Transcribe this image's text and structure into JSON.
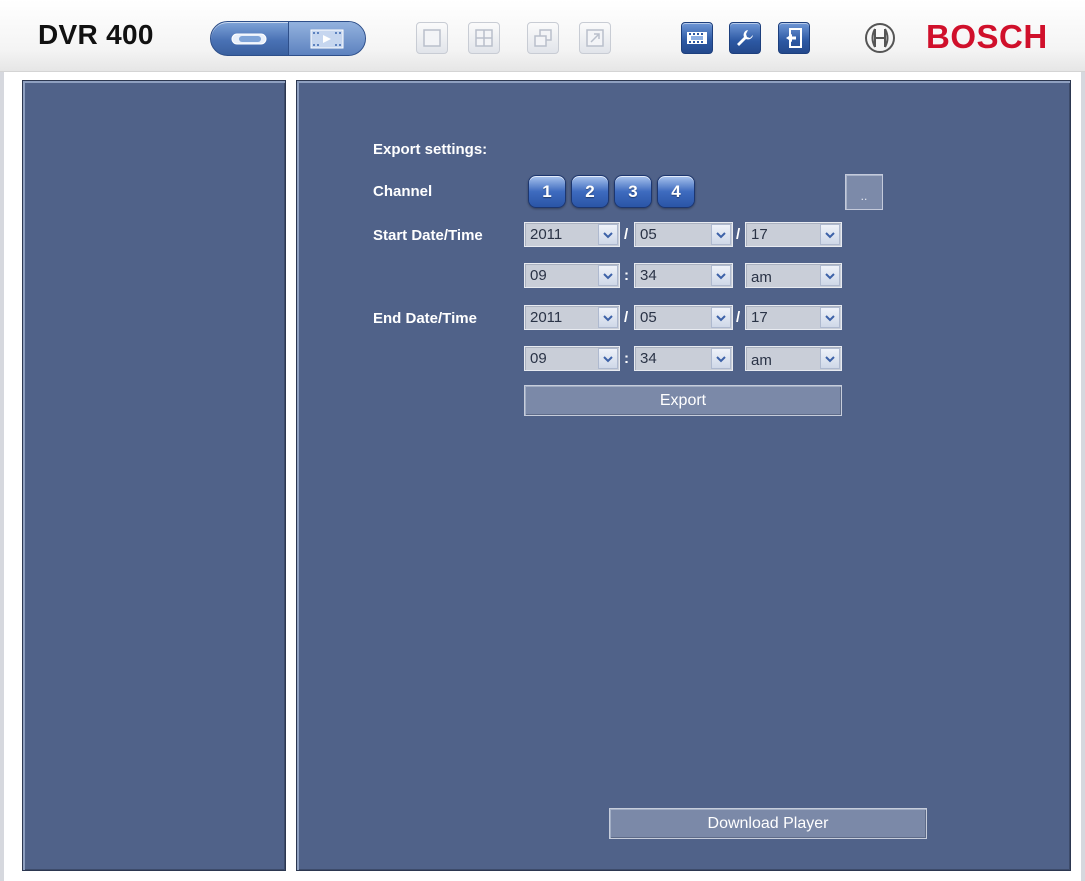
{
  "header": {
    "title": "DVR 400",
    "brand": "BOSCH",
    "icons": {
      "live": "live-view-icon",
      "playback": "playback-icon",
      "single_view": "single-view-icon",
      "quad_view": "quad-view-icon",
      "restore": "restore-window-icon",
      "fullscreen": "fullscreen-icon",
      "export": "export-film-icon",
      "settings": "wrench-icon",
      "logout": "logout-door-icon",
      "emblem": "bosch-emblem-icon"
    }
  },
  "export": {
    "heading": "Export settings:",
    "channel_label": "Channel",
    "channels": [
      "1",
      "2",
      "3",
      "4"
    ],
    "more_button": "..",
    "start_label": "Start Date/Time",
    "end_label": "End Date/Time",
    "start": {
      "year": "2011",
      "month": "05",
      "day": "17",
      "hour": "09",
      "minute": "34",
      "ampm": "am"
    },
    "end": {
      "year": "2011",
      "month": "05",
      "day": "17",
      "hour": "09",
      "minute": "34",
      "ampm": "am"
    },
    "date_sep": "/",
    "time_sep": ":",
    "export_button": "Export"
  },
  "footer": {
    "download_button": "Download Player"
  },
  "colors": {
    "panel": "#506289",
    "brand_red": "#d0102b",
    "accent_blue": "#2c58a3"
  }
}
